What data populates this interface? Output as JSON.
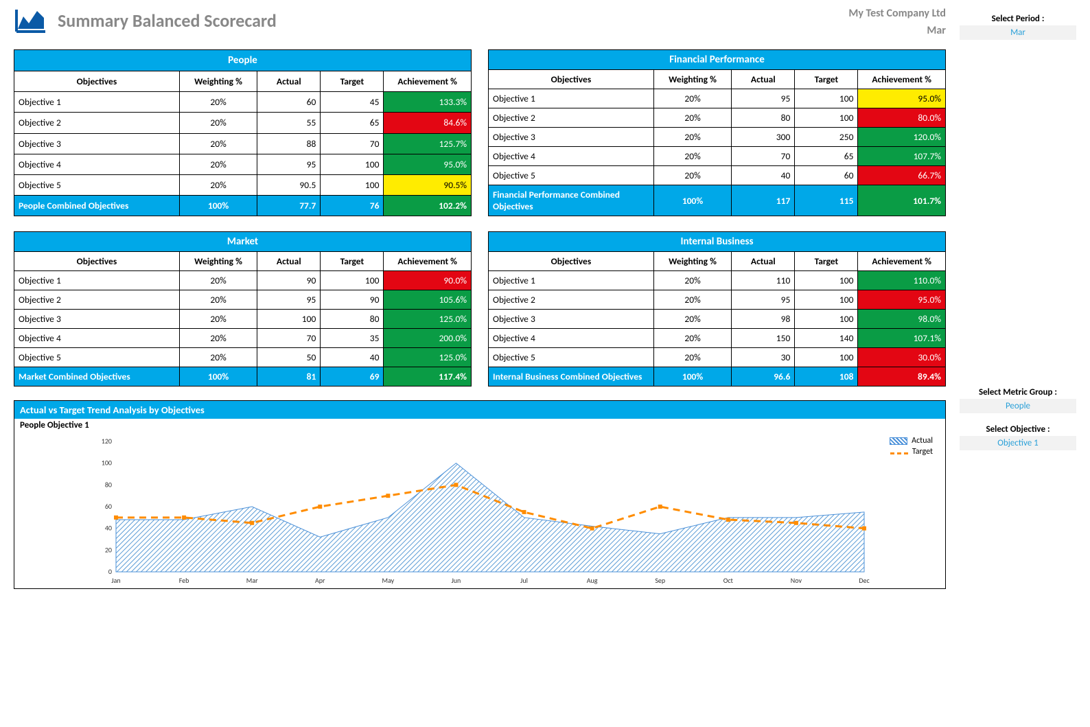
{
  "header": {
    "title": "Summary Balanced Scorecard",
    "company": "My Test Company Ltd",
    "month": "Mar"
  },
  "sidebar": {
    "period_label": "Select Period :",
    "period_value": "Mar",
    "metric_group_label": "Select Metric Group :",
    "metric_group_value": "People",
    "objective_label": "Select Objective :",
    "objective_value": "Objective 1"
  },
  "columns": {
    "obj": "Objectives",
    "weight": "Weighting %",
    "actual": "Actual",
    "target": "Target",
    "ach": "Achievement %"
  },
  "legend": {
    "actual": "Actual",
    "target": "Target"
  },
  "quadrants": [
    {
      "title": "People",
      "rows": [
        {
          "obj": "Objective 1",
          "w": "20%",
          "a": "60",
          "t": "45",
          "ach": "133.3%",
          "cls": "g"
        },
        {
          "obj": "Objective 2",
          "w": "20%",
          "a": "55",
          "t": "65",
          "ach": "84.6%",
          "cls": "r"
        },
        {
          "obj": "Objective 3",
          "w": "20%",
          "a": "88",
          "t": "70",
          "ach": "125.7%",
          "cls": "g"
        },
        {
          "obj": "Objective 4",
          "w": "20%",
          "a": "95",
          "t": "100",
          "ach": "95.0%",
          "cls": "g"
        },
        {
          "obj": "Objective 5",
          "w": "20%",
          "a": "90.5",
          "t": "100",
          "ach": "90.5%",
          "cls": "y"
        }
      ],
      "footer": {
        "obj": "People Combined Objectives",
        "w": "100%",
        "a": "77.7",
        "t": "76",
        "ach": "102.2%",
        "cls": "g"
      }
    },
    {
      "title": "Financial Performance",
      "rows": [
        {
          "obj": "Objective 1",
          "w": "20%",
          "a": "95",
          "t": "100",
          "ach": "95.0%",
          "cls": "y"
        },
        {
          "obj": "Objective 2",
          "w": "20%",
          "a": "80",
          "t": "100",
          "ach": "80.0%",
          "cls": "r"
        },
        {
          "obj": "Objective 3",
          "w": "20%",
          "a": "300",
          "t": "250",
          "ach": "120.0%",
          "cls": "g"
        },
        {
          "obj": "Objective 4",
          "w": "20%",
          "a": "70",
          "t": "65",
          "ach": "107.7%",
          "cls": "g"
        },
        {
          "obj": "Objective 5",
          "w": "20%",
          "a": "40",
          "t": "60",
          "ach": "66.7%",
          "cls": "r"
        }
      ],
      "footer": {
        "obj": "Financial Performance Combined Objectives",
        "w": "100%",
        "a": "117",
        "t": "115",
        "ach": "101.7%",
        "cls": "g"
      }
    },
    {
      "title": "Market",
      "rows": [
        {
          "obj": "Objective 1",
          "w": "20%",
          "a": "90",
          "t": "100",
          "ach": "90.0%",
          "cls": "r"
        },
        {
          "obj": "Objective 2",
          "w": "20%",
          "a": "95",
          "t": "90",
          "ach": "105.6%",
          "cls": "g"
        },
        {
          "obj": "Objective 3",
          "w": "20%",
          "a": "100",
          "t": "80",
          "ach": "125.0%",
          "cls": "g"
        },
        {
          "obj": "Objective 4",
          "w": "20%",
          "a": "70",
          "t": "35",
          "ach": "200.0%",
          "cls": "g"
        },
        {
          "obj": "Objective 5",
          "w": "20%",
          "a": "50",
          "t": "40",
          "ach": "125.0%",
          "cls": "g"
        }
      ],
      "footer": {
        "obj": "Market Combined Objectives",
        "w": "100%",
        "a": "81",
        "t": "69",
        "ach": "117.4%",
        "cls": "g"
      }
    },
    {
      "title": "Internal Business",
      "rows": [
        {
          "obj": "Objective 1",
          "w": "20%",
          "a": "110",
          "t": "100",
          "ach": "110.0%",
          "cls": "g"
        },
        {
          "obj": "Objective 2",
          "w": "20%",
          "a": "95",
          "t": "100",
          "ach": "95.0%",
          "cls": "r"
        },
        {
          "obj": "Objective 3",
          "w": "20%",
          "a": "98",
          "t": "100",
          "ach": "98.0%",
          "cls": "g"
        },
        {
          "obj": "Objective 4",
          "w": "20%",
          "a": "150",
          "t": "140",
          "ach": "107.1%",
          "cls": "g"
        },
        {
          "obj": "Objective 5",
          "w": "20%",
          "a": "30",
          "t": "100",
          "ach": "30.0%",
          "cls": "r"
        }
      ],
      "footer": {
        "obj": "Internal Business Combined Objectives",
        "w": "100%",
        "a": "96.6",
        "t": "108",
        "ach": "89.4%",
        "cls": "r"
      }
    }
  ],
  "chart": {
    "title": "Actual vs Target Trend Analysis by Objectives",
    "subtitle": "People Objective 1"
  },
  "chart_data": {
    "type": "line",
    "title": "Actual vs Target Trend Analysis by Objectives — People Objective 1",
    "xlabel": "",
    "ylabel": "",
    "ylim": [
      0,
      120
    ],
    "yticks": [
      0,
      20,
      40,
      60,
      80,
      100,
      120
    ],
    "categories": [
      "Jan",
      "Feb",
      "Mar",
      "Apr",
      "May",
      "Jun",
      "Jul",
      "Aug",
      "Sep",
      "Oct",
      "Nov",
      "Dec"
    ],
    "series": [
      {
        "name": "Actual",
        "type": "area",
        "values": [
          48,
          48,
          60,
          32,
          50,
          100,
          50,
          42,
          35,
          50,
          50,
          55
        ]
      },
      {
        "name": "Target",
        "type": "dashed-line",
        "values": [
          50,
          50,
          45,
          60,
          70,
          80,
          55,
          40,
          60,
          48,
          45,
          40
        ]
      }
    ]
  }
}
